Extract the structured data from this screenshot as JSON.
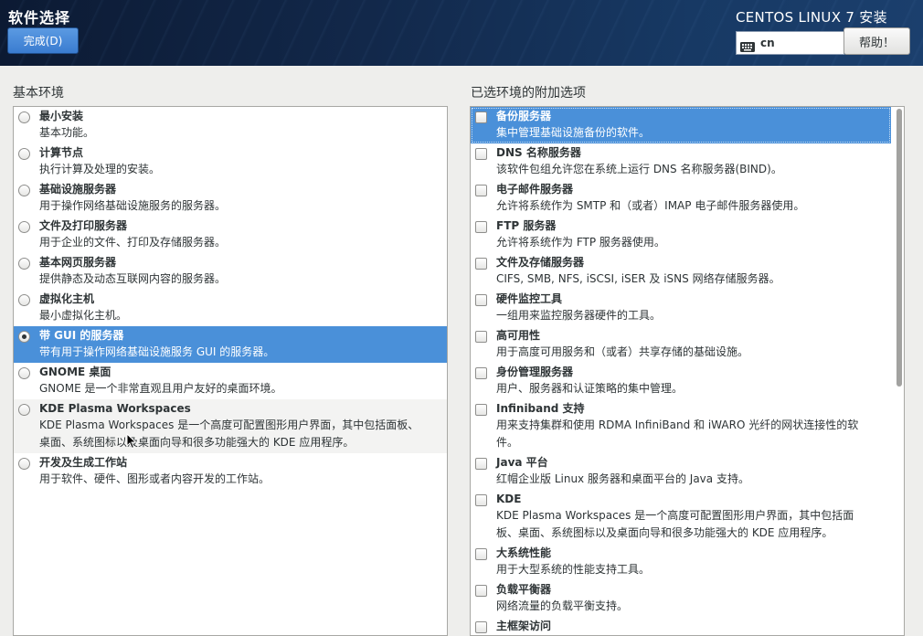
{
  "header": {
    "title": "软件选择",
    "done_label": "完成(D)",
    "product": "CENTOS LINUX 7 安装",
    "keyboard_layout": "cn",
    "help_label": "帮助！"
  },
  "base_env": {
    "label": "基本环境",
    "items": [
      {
        "name": "最小安装",
        "desc": [
          "基本功能。"
        ]
      },
      {
        "name": "计算节点",
        "desc": [
          "执行计算及处理的安装。"
        ]
      },
      {
        "name": "基础设施服务器",
        "desc": [
          "用于操作网络基础设施服务的服务器。"
        ]
      },
      {
        "name": "文件及打印服务器",
        "desc": [
          "用于企业的文件、打印及存储服务器。"
        ]
      },
      {
        "name": "基本网页服务器",
        "desc": [
          "提供静态及动态互联网内容的服务器。"
        ]
      },
      {
        "name": "虚拟化主机",
        "desc": [
          "最小虚拟化主机。"
        ]
      },
      {
        "name": "带 GUI 的服务器",
        "desc": [
          "带有用于操作网络基础设施服务 GUI 的服务器。"
        ]
      },
      {
        "name": "GNOME 桌面",
        "desc": [
          "GNOME 是一个非常直观且用户友好的桌面环境。"
        ]
      },
      {
        "name": "KDE Plasma Workspaces",
        "desc": [
          "KDE Plasma Workspaces 是一个高度可配置图形用户界面，其中包括面板、",
          "桌面、系统图标以及桌面向导和很多功能强大的 KDE 应用程序。"
        ]
      },
      {
        "name": "开发及生成工作站",
        "desc": [
          "用于软件、硬件、图形或者内容开发的工作站。"
        ]
      }
    ],
    "selected_index": 6
  },
  "addons": {
    "label": "已选环境的附加选项",
    "items": [
      {
        "name": "备份服务器",
        "desc": [
          "集中管理基础设施备份的软件。"
        ]
      },
      {
        "name": "DNS 名称服务器",
        "desc": [
          "该软件包组允许您在系统上运行 DNS 名称服务器(BIND)。"
        ]
      },
      {
        "name": "电子邮件服务器",
        "desc": [
          "允许将系统作为 SMTP 和（或者）IMAP 电子邮件服务器使用。"
        ]
      },
      {
        "name": "FTP 服务器",
        "desc": [
          "允许将系统作为 FTP 服务器使用。"
        ]
      },
      {
        "name": "文件及存储服务器",
        "desc": [
          "CIFS, SMB, NFS, iSCSI, iSER 及 iSNS 网络存储服务器。"
        ]
      },
      {
        "name": "硬件监控工具",
        "desc": [
          "一组用来监控服务器硬件的工具。"
        ]
      },
      {
        "name": "高可用性",
        "desc": [
          "用于高度可用服务和（或者）共享存储的基础设施。"
        ]
      },
      {
        "name": "身份管理服务器",
        "desc": [
          "用户、服务器和认证策略的集中管理。"
        ]
      },
      {
        "name": "Infiniband 支持",
        "desc": [
          "用来支持集群和使用 RDMA InfiniBand 和 iWARO 光纤的网状连接性的软",
          "件。"
        ]
      },
      {
        "name": "Java 平台",
        "desc": [
          "红帽企业版 Linux 服务器和桌面平台的 Java 支持。"
        ]
      },
      {
        "name": "KDE",
        "desc": [
          "KDE Plasma Workspaces 是一个高度可配置图形用户界面，其中包括面",
          "板、桌面、系统图标以及桌面向导和很多功能强大的 KDE 应用程序。"
        ]
      },
      {
        "name": "大系统性能",
        "desc": [
          "用于大型系统的性能支持工具。"
        ]
      },
      {
        "name": "负载平衡器",
        "desc": [
          "网络流量的负载平衡支持。"
        ]
      },
      {
        "name": "主框架访问",
        "desc": []
      }
    ],
    "highlighted_index": 0
  },
  "colors": {
    "selection": "#4a90d9",
    "header_dark": "#0c1a33",
    "header_light": "#1b3f6d"
  }
}
